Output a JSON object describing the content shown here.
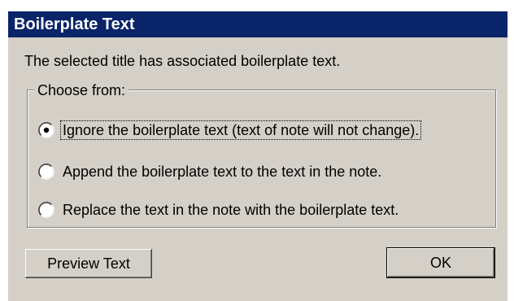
{
  "window": {
    "title": "Boilerplate Text"
  },
  "message": "The selected title has associated boilerplate text.",
  "group": {
    "label": "Choose from:",
    "options": [
      {
        "label": "Ignore the boilerplate text (text of note will not change).",
        "selected": true
      },
      {
        "label": "Append the boilerplate text to the text in the note.",
        "selected": false
      },
      {
        "label": "Replace the text in the note with the boilerplate text.",
        "selected": false
      }
    ]
  },
  "buttons": {
    "preview_label": "Preview Text",
    "ok_label": "OK"
  },
  "colors": {
    "titlebar": "#0a246a",
    "face": "#d4d0c8",
    "title_text": "#ffffff"
  }
}
